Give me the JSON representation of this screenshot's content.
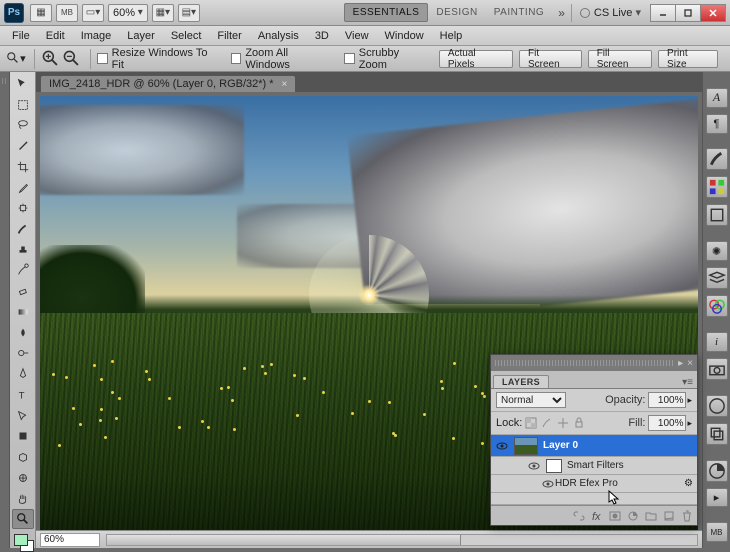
{
  "titlebar": {
    "zoom_dropdown": "60%",
    "workspace_tabs": [
      "ESSENTIALS",
      "DESIGN",
      "PAINTING"
    ],
    "active_ws": 0,
    "cs_live": "CS Live"
  },
  "menubar": [
    "File",
    "Edit",
    "Image",
    "Layer",
    "Select",
    "Filter",
    "Analysis",
    "3D",
    "View",
    "Window",
    "Help"
  ],
  "options": {
    "resize_windows": "Resize Windows To Fit",
    "zoom_all": "Zoom All Windows",
    "scrubby": "Scrubby Zoom",
    "buttons": [
      "Actual Pixels",
      "Fit Screen",
      "Fill Screen",
      "Print Size"
    ]
  },
  "document": {
    "tab_title": "IMG_2418_HDR @ 60% (Layer 0, RGB/32*) *",
    "zoom_status": "60%"
  },
  "layers_panel": {
    "title": "LAYERS",
    "blend_mode": "Normal",
    "opacity_label": "Opacity:",
    "opacity_value": "100%",
    "lock_label": "Lock:",
    "fill_label": "Fill:",
    "fill_value": "100%",
    "items": [
      {
        "name": "Layer 0",
        "selected": true
      },
      {
        "name": "Smart Filters",
        "sub": true
      },
      {
        "name": "HDR Efex Pro",
        "sub2": true
      }
    ]
  },
  "right_dock_icons": [
    "character-icon",
    "paragraph-icon",
    "brush-icon",
    "swatches-icon",
    "styles-icon",
    "star-icon",
    "layers-icon",
    "channels-icon",
    "info-icon",
    "camera-icon",
    "color-icon",
    "clone-icon",
    "adjustments-icon",
    "actions-icon",
    "mb-icon"
  ]
}
